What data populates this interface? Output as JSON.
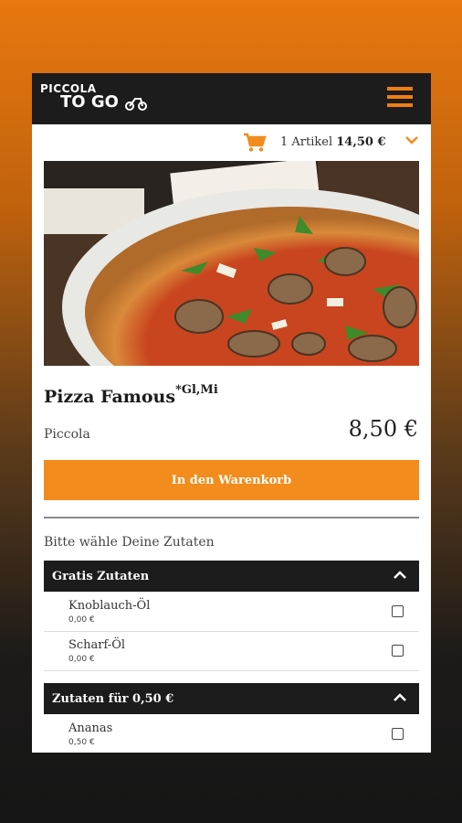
{
  "logo": {
    "line1": "PICCOLA",
    "line2": "TO GO"
  },
  "cart": {
    "count_label": "1 Artikel",
    "total": "14,50 €"
  },
  "product": {
    "name": "Pizza Famous",
    "allergens": "*Gl,Mi",
    "size": "Piccola",
    "price": "8,50 €"
  },
  "add_button": "In den Warenkorb",
  "prompt": "Bitte wähle Deine Zutaten",
  "groups": [
    {
      "title": "Gratis Zutaten",
      "items": [
        {
          "name": "Knoblauch-Öl",
          "price": "0,00 €"
        },
        {
          "name": "Scharf-Öl",
          "price": "0,00 €"
        }
      ]
    },
    {
      "title": "Zutaten für 0,50 €",
      "items": [
        {
          "name": "Ananas",
          "price": "0,50 €"
        }
      ]
    }
  ],
  "colors": {
    "accent": "#f28c1c",
    "dark": "#1c1c1c"
  }
}
